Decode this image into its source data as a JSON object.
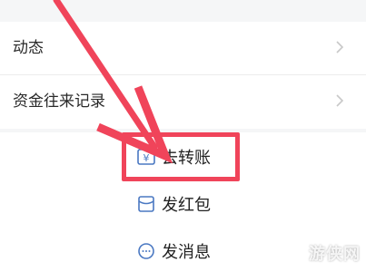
{
  "list": {
    "items": [
      {
        "label": "动态"
      },
      {
        "label": "资金往来记录"
      }
    ]
  },
  "actions": [
    {
      "label": "去转账",
      "icon": "transfer-yuan-icon"
    },
    {
      "label": "发红包",
      "icon": "red-packet-icon"
    },
    {
      "label": "发消息",
      "icon": "chat-bubble-icon"
    }
  ],
  "annotation": {
    "arrow_color": "#f0445a",
    "box_color": "#f0445a",
    "icon_color": "#4a78c2"
  },
  "watermark": {
    "text": "游侠网"
  }
}
